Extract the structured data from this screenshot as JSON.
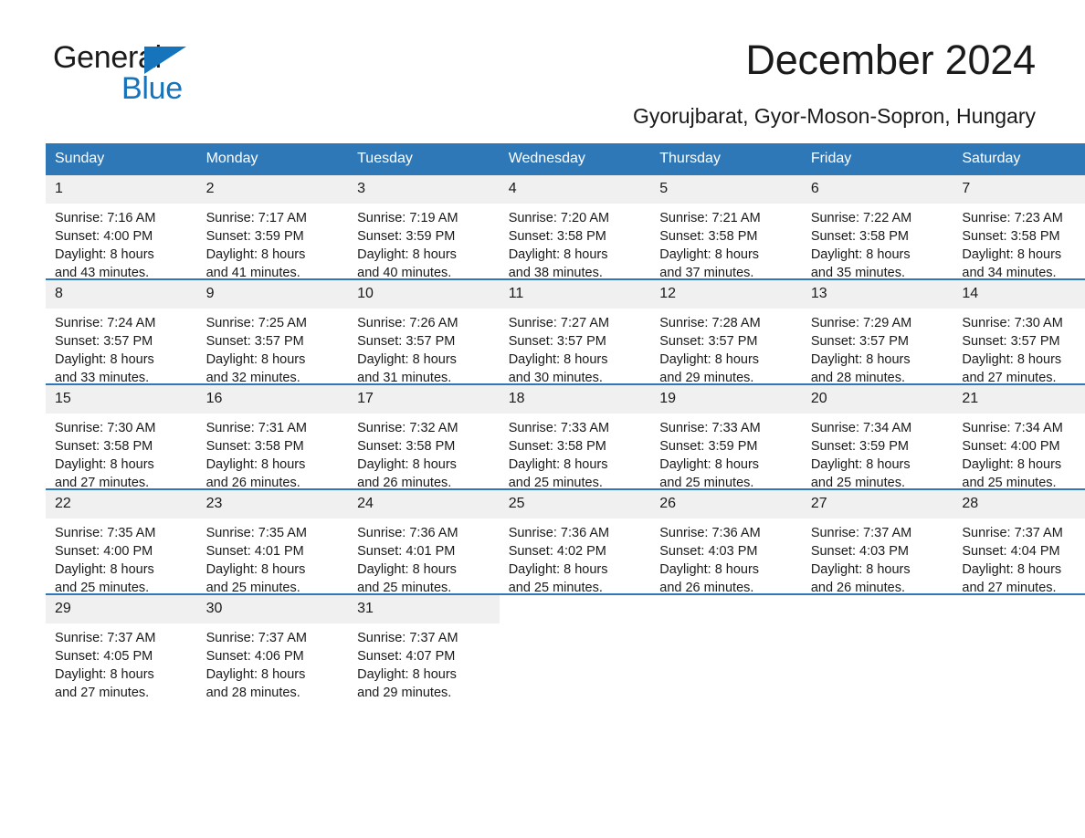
{
  "brand": {
    "word1": "General",
    "word2": "Blue",
    "triangle_color": "#1574bb",
    "icon": "triangle-logo-icon"
  },
  "header": {
    "title": "December 2024",
    "subtitle": "Gyorujbarat, Gyor-Moson-Sopron, Hungary"
  },
  "theme": {
    "header_blue": "#2f78b7",
    "daynum_gray": "#f0f0f0",
    "text": "#1a1a1a",
    "background": "#ffffff"
  },
  "calendar": {
    "weekday_headers": [
      "Sunday",
      "Monday",
      "Tuesday",
      "Wednesday",
      "Thursday",
      "Friday",
      "Saturday"
    ],
    "labels": {
      "sunrise_prefix": "Sunrise:",
      "sunset_prefix": "Sunset:",
      "daylight_prefix": "Daylight:"
    },
    "weeks": [
      [
        {
          "day": "1",
          "sunrise": "Sunrise: 7:16 AM",
          "sunset": "Sunset: 4:00 PM",
          "daylight_line1": "Daylight: 8 hours",
          "daylight_line2": "and 43 minutes."
        },
        {
          "day": "2",
          "sunrise": "Sunrise: 7:17 AM",
          "sunset": "Sunset: 3:59 PM",
          "daylight_line1": "Daylight: 8 hours",
          "daylight_line2": "and 41 minutes."
        },
        {
          "day": "3",
          "sunrise": "Sunrise: 7:19 AM",
          "sunset": "Sunset: 3:59 PM",
          "daylight_line1": "Daylight: 8 hours",
          "daylight_line2": "and 40 minutes."
        },
        {
          "day": "4",
          "sunrise": "Sunrise: 7:20 AM",
          "sunset": "Sunset: 3:58 PM",
          "daylight_line1": "Daylight: 8 hours",
          "daylight_line2": "and 38 minutes."
        },
        {
          "day": "5",
          "sunrise": "Sunrise: 7:21 AM",
          "sunset": "Sunset: 3:58 PM",
          "daylight_line1": "Daylight: 8 hours",
          "daylight_line2": "and 37 minutes."
        },
        {
          "day": "6",
          "sunrise": "Sunrise: 7:22 AM",
          "sunset": "Sunset: 3:58 PM",
          "daylight_line1": "Daylight: 8 hours",
          "daylight_line2": "and 35 minutes."
        },
        {
          "day": "7",
          "sunrise": "Sunrise: 7:23 AM",
          "sunset": "Sunset: 3:58 PM",
          "daylight_line1": "Daylight: 8 hours",
          "daylight_line2": "and 34 minutes."
        }
      ],
      [
        {
          "day": "8",
          "sunrise": "Sunrise: 7:24 AM",
          "sunset": "Sunset: 3:57 PM",
          "daylight_line1": "Daylight: 8 hours",
          "daylight_line2": "and 33 minutes."
        },
        {
          "day": "9",
          "sunrise": "Sunrise: 7:25 AM",
          "sunset": "Sunset: 3:57 PM",
          "daylight_line1": "Daylight: 8 hours",
          "daylight_line2": "and 32 minutes."
        },
        {
          "day": "10",
          "sunrise": "Sunrise: 7:26 AM",
          "sunset": "Sunset: 3:57 PM",
          "daylight_line1": "Daylight: 8 hours",
          "daylight_line2": "and 31 minutes."
        },
        {
          "day": "11",
          "sunrise": "Sunrise: 7:27 AM",
          "sunset": "Sunset: 3:57 PM",
          "daylight_line1": "Daylight: 8 hours",
          "daylight_line2": "and 30 minutes."
        },
        {
          "day": "12",
          "sunrise": "Sunrise: 7:28 AM",
          "sunset": "Sunset: 3:57 PM",
          "daylight_line1": "Daylight: 8 hours",
          "daylight_line2": "and 29 minutes."
        },
        {
          "day": "13",
          "sunrise": "Sunrise: 7:29 AM",
          "sunset": "Sunset: 3:57 PM",
          "daylight_line1": "Daylight: 8 hours",
          "daylight_line2": "and 28 minutes."
        },
        {
          "day": "14",
          "sunrise": "Sunrise: 7:30 AM",
          "sunset": "Sunset: 3:57 PM",
          "daylight_line1": "Daylight: 8 hours",
          "daylight_line2": "and 27 minutes."
        }
      ],
      [
        {
          "day": "15",
          "sunrise": "Sunrise: 7:30 AM",
          "sunset": "Sunset: 3:58 PM",
          "daylight_line1": "Daylight: 8 hours",
          "daylight_line2": "and 27 minutes."
        },
        {
          "day": "16",
          "sunrise": "Sunrise: 7:31 AM",
          "sunset": "Sunset: 3:58 PM",
          "daylight_line1": "Daylight: 8 hours",
          "daylight_line2": "and 26 minutes."
        },
        {
          "day": "17",
          "sunrise": "Sunrise: 7:32 AM",
          "sunset": "Sunset: 3:58 PM",
          "daylight_line1": "Daylight: 8 hours",
          "daylight_line2": "and 26 minutes."
        },
        {
          "day": "18",
          "sunrise": "Sunrise: 7:33 AM",
          "sunset": "Sunset: 3:58 PM",
          "daylight_line1": "Daylight: 8 hours",
          "daylight_line2": "and 25 minutes."
        },
        {
          "day": "19",
          "sunrise": "Sunrise: 7:33 AM",
          "sunset": "Sunset: 3:59 PM",
          "daylight_line1": "Daylight: 8 hours",
          "daylight_line2": "and 25 minutes."
        },
        {
          "day": "20",
          "sunrise": "Sunrise: 7:34 AM",
          "sunset": "Sunset: 3:59 PM",
          "daylight_line1": "Daylight: 8 hours",
          "daylight_line2": "and 25 minutes."
        },
        {
          "day": "21",
          "sunrise": "Sunrise: 7:34 AM",
          "sunset": "Sunset: 4:00 PM",
          "daylight_line1": "Daylight: 8 hours",
          "daylight_line2": "and 25 minutes."
        }
      ],
      [
        {
          "day": "22",
          "sunrise": "Sunrise: 7:35 AM",
          "sunset": "Sunset: 4:00 PM",
          "daylight_line1": "Daylight: 8 hours",
          "daylight_line2": "and 25 minutes."
        },
        {
          "day": "23",
          "sunrise": "Sunrise: 7:35 AM",
          "sunset": "Sunset: 4:01 PM",
          "daylight_line1": "Daylight: 8 hours",
          "daylight_line2": "and 25 minutes."
        },
        {
          "day": "24",
          "sunrise": "Sunrise: 7:36 AM",
          "sunset": "Sunset: 4:01 PM",
          "daylight_line1": "Daylight: 8 hours",
          "daylight_line2": "and 25 minutes."
        },
        {
          "day": "25",
          "sunrise": "Sunrise: 7:36 AM",
          "sunset": "Sunset: 4:02 PM",
          "daylight_line1": "Daylight: 8 hours",
          "daylight_line2": "and 25 minutes."
        },
        {
          "day": "26",
          "sunrise": "Sunrise: 7:36 AM",
          "sunset": "Sunset: 4:03 PM",
          "daylight_line1": "Daylight: 8 hours",
          "daylight_line2": "and 26 minutes."
        },
        {
          "day": "27",
          "sunrise": "Sunrise: 7:37 AM",
          "sunset": "Sunset: 4:03 PM",
          "daylight_line1": "Daylight: 8 hours",
          "daylight_line2": "and 26 minutes."
        },
        {
          "day": "28",
          "sunrise": "Sunrise: 7:37 AM",
          "sunset": "Sunset: 4:04 PM",
          "daylight_line1": "Daylight: 8 hours",
          "daylight_line2": "and 27 minutes."
        }
      ],
      [
        {
          "day": "29",
          "sunrise": "Sunrise: 7:37 AM",
          "sunset": "Sunset: 4:05 PM",
          "daylight_line1": "Daylight: 8 hours",
          "daylight_line2": "and 27 minutes."
        },
        {
          "day": "30",
          "sunrise": "Sunrise: 7:37 AM",
          "sunset": "Sunset: 4:06 PM",
          "daylight_line1": "Daylight: 8 hours",
          "daylight_line2": "and 28 minutes."
        },
        {
          "day": "31",
          "sunrise": "Sunrise: 7:37 AM",
          "sunset": "Sunset: 4:07 PM",
          "daylight_line1": "Daylight: 8 hours",
          "daylight_line2": "and 29 minutes."
        },
        {
          "day": "",
          "sunrise": "",
          "sunset": "",
          "daylight_line1": "",
          "daylight_line2": "",
          "empty": true
        },
        {
          "day": "",
          "sunrise": "",
          "sunset": "",
          "daylight_line1": "",
          "daylight_line2": "",
          "empty": true
        },
        {
          "day": "",
          "sunrise": "",
          "sunset": "",
          "daylight_line1": "",
          "daylight_line2": "",
          "empty": true
        },
        {
          "day": "",
          "sunrise": "",
          "sunset": "",
          "daylight_line1": "",
          "daylight_line2": "",
          "empty": true
        }
      ]
    ]
  }
}
